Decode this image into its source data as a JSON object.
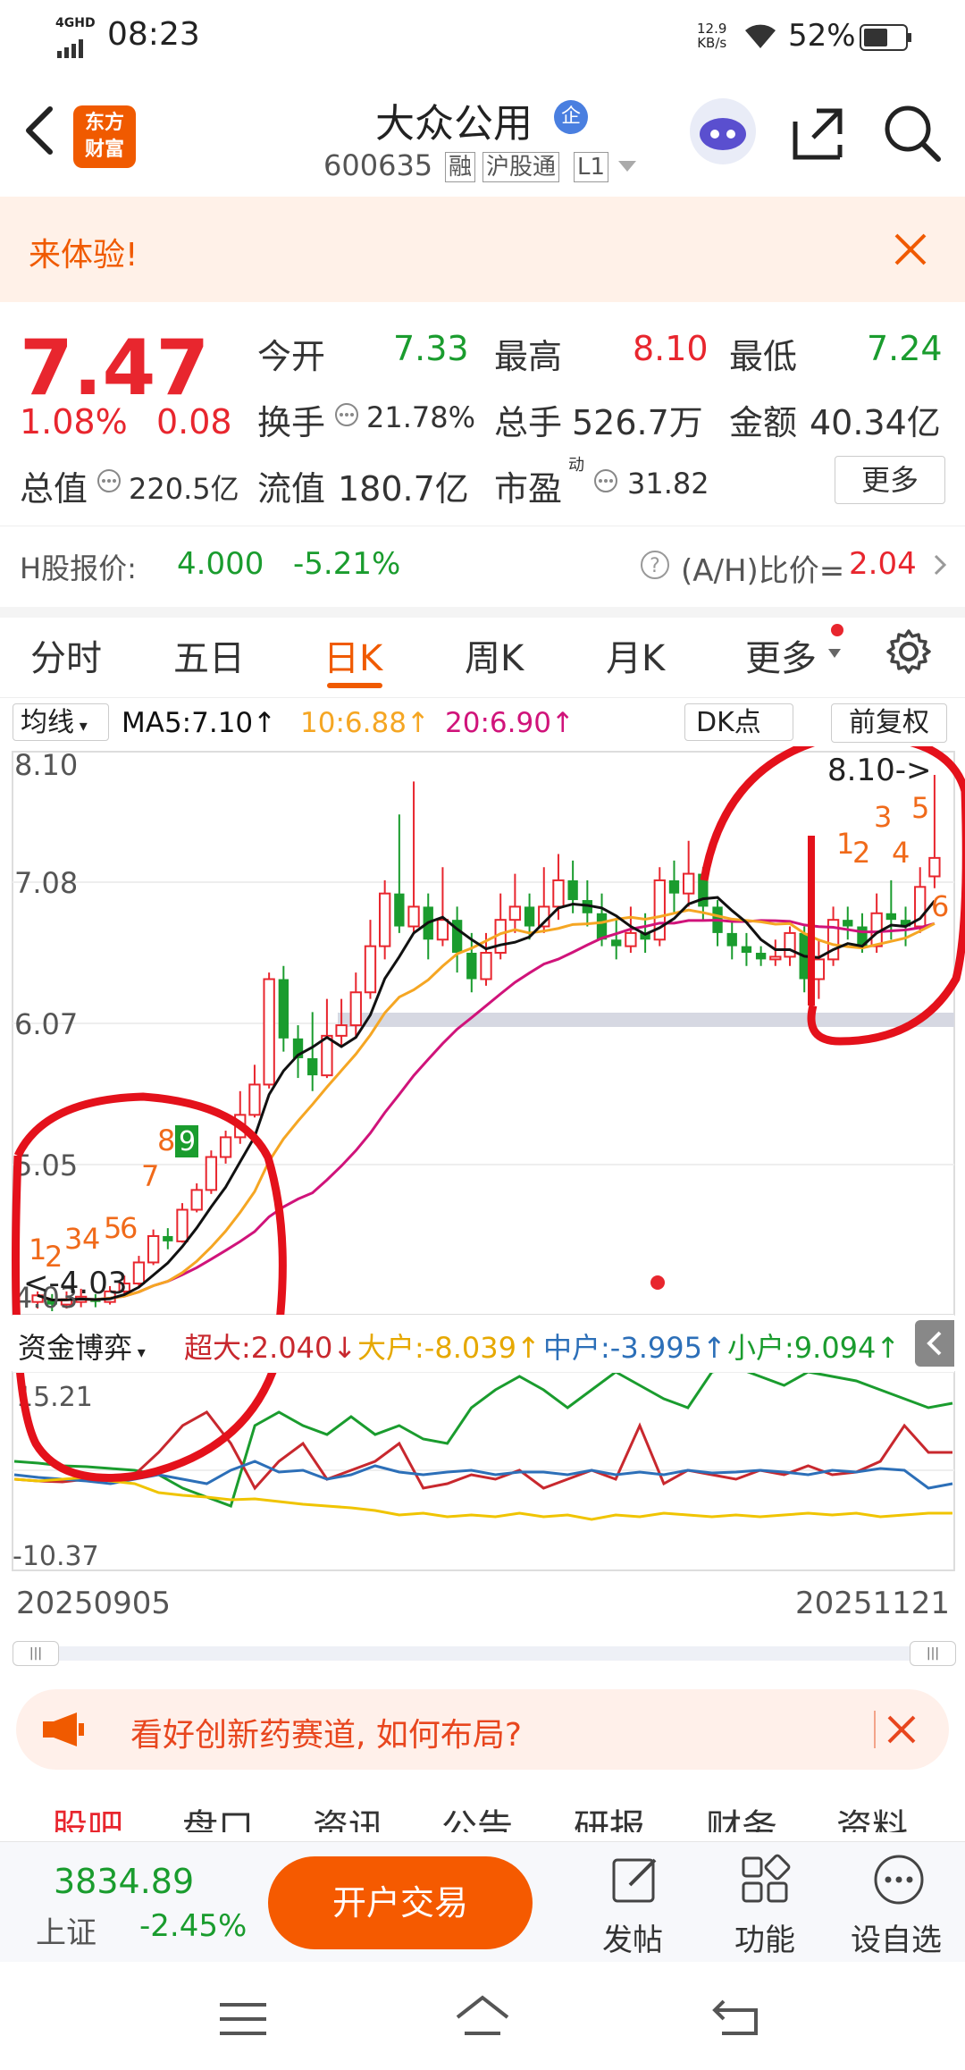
{
  "status": {
    "network": "4GHD",
    "time": "08:23",
    "speed_value": "12.9",
    "speed_unit": "KB/s",
    "battery": "52%"
  },
  "header": {
    "logo_line1": "东方",
    "logo_line2": "财富",
    "title": "大众公用",
    "title_badge": "企",
    "code": "600635",
    "tag1": "融",
    "tag2": "沪股通",
    "tag3": "L1"
  },
  "banner": {
    "text": "来体验!"
  },
  "quote": {
    "price": "7.47",
    "change_pct": "1.08%",
    "change": "0.08",
    "open_label": "今开",
    "open": "7.33",
    "high_label": "最高",
    "high": "8.10",
    "low_label": "最低",
    "low": "7.24",
    "turnover_label": "换手",
    "turnover": "21.78%",
    "volume_label": "总手",
    "volume": "526.7万",
    "amount_label": "金额",
    "amount": "40.34亿",
    "mktcap_label": "总值",
    "mktcap": "220.5亿",
    "float_label": "流值",
    "float": "180.7亿",
    "pe_label": "市盈",
    "pe_sup": "动",
    "pe": "31.82",
    "more_label": "更多"
  },
  "hshare": {
    "label": "H股报价:",
    "price": "4.000",
    "change": "-5.21%",
    "ratio_label": "(A/H)比价=",
    "ratio": "2.04"
  },
  "tabs": [
    "分时",
    "五日",
    "日K",
    "周K",
    "月K",
    "更多"
  ],
  "ma": {
    "selector": "均线",
    "ma5": "MA5:7.10↑",
    "ma10": "10:6.88↑",
    "ma20": "20:6.90↑",
    "dk": "DK点",
    "adjust": "前复权"
  },
  "kchart": {
    "y_labels": [
      "8.10",
      "7.08",
      "6.07",
      "5.05",
      "4.03"
    ],
    "high_marker": "8.10->",
    "low_marker": "<-4.03",
    "date_start": "20250905",
    "date_end": "20251121"
  },
  "flow": {
    "selector": "资金博弈",
    "chaoda": "超大:2.040↓",
    "dahu": "大户:-8.039↑",
    "zhonghu": "中户:-3.995↑",
    "xiaohu": "小户:9.094↑",
    "y_top": "15.21",
    "y_bottom": "-10.37"
  },
  "ad": {
    "text": "看好创新药赛道, 如何布局?"
  },
  "bottom_tabs": [
    "股吧",
    "盘口",
    "资讯",
    "公告",
    "研报",
    "财务",
    "资料"
  ],
  "footer": {
    "index_value": "3834.89",
    "index_name": "上证",
    "index_change": "-2.45%",
    "trade_button": "开户交易",
    "post": "发帖",
    "function": "功能",
    "watchlist": "设自选"
  },
  "colors": {
    "up": "#e8262e",
    "down": "#1a9c2e",
    "accent": "#f05a00",
    "ma5": "#111111",
    "ma10": "#f5a623",
    "ma20": "#d0137a"
  }
}
